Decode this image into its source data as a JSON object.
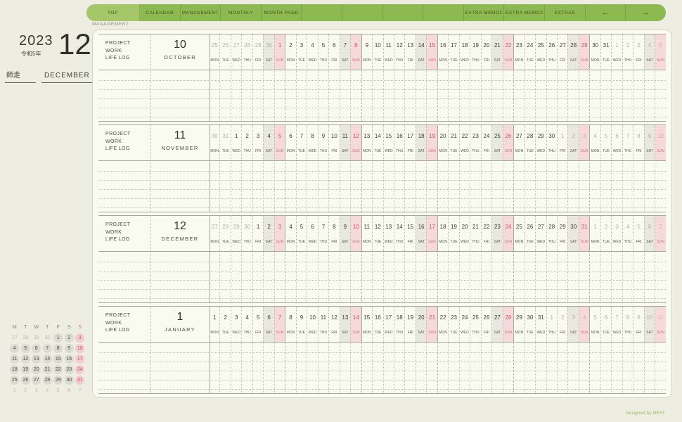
{
  "tab_bar": {
    "left_tabs": [
      "TOP",
      "CALENDAR",
      "MANAGEMENT",
      "MONTHLY",
      "MONTH PAGE"
    ],
    "right_tabs": [
      "EXTRA MEMO1",
      "EXTRA MEMO2",
      "EXTRAS"
    ],
    "nav_arrows": [
      "←",
      "→"
    ],
    "active_tab": "TOP"
  },
  "page_label": "MANAGEMENT",
  "title_block": {
    "year": "2023",
    "era": "令和5年",
    "month_number": "12",
    "month_jp": "師走",
    "month_en": "DECEMBER"
  },
  "row_labels": [
    "PROJECT",
    "WORK",
    "LIFE LOG"
  ],
  "weekday_labels": [
    "MON",
    "TUE",
    "WED",
    "THU",
    "FRI",
    "SAT",
    "SUN"
  ],
  "months": [
    {
      "number": "10",
      "name": "OCTOBER",
      "out_before": 6,
      "out_after": 5,
      "dates": [
        25,
        26,
        27,
        28,
        29,
        30,
        1,
        2,
        3,
        4,
        5,
        6,
        7,
        8,
        9,
        10,
        11,
        12,
        13,
        14,
        15,
        16,
        17,
        18,
        19,
        20,
        21,
        22,
        23,
        24,
        25,
        26,
        27,
        28,
        29,
        30,
        31,
        1,
        2,
        3,
        4,
        5
      ]
    },
    {
      "number": "11",
      "name": "NOVEMBER",
      "out_before": 2,
      "out_after": 10,
      "dates": [
        30,
        31,
        1,
        2,
        3,
        4,
        5,
        6,
        7,
        8,
        9,
        10,
        11,
        12,
        13,
        14,
        15,
        16,
        17,
        18,
        19,
        20,
        21,
        22,
        23,
        24,
        25,
        26,
        27,
        28,
        29,
        30,
        1,
        2,
        3,
        4,
        5,
        6,
        7,
        8,
        9,
        10
      ]
    },
    {
      "number": "12",
      "name": "DECEMBER",
      "out_before": 4,
      "out_after": 7,
      "dates": [
        27,
        28,
        29,
        30,
        1,
        2,
        3,
        4,
        5,
        6,
        7,
        8,
        9,
        10,
        11,
        12,
        13,
        14,
        15,
        16,
        17,
        18,
        19,
        20,
        21,
        22,
        23,
        24,
        25,
        26,
        27,
        28,
        29,
        30,
        31,
        1,
        2,
        3,
        4,
        5,
        6,
        7
      ]
    },
    {
      "number": "1",
      "name": "JANUARY",
      "out_before": 0,
      "out_after": 11,
      "dates": [
        1,
        2,
        3,
        4,
        5,
        6,
        7,
        8,
        9,
        10,
        11,
        12,
        13,
        14,
        15,
        16,
        17,
        18,
        19,
        20,
        21,
        22,
        23,
        24,
        25,
        26,
        27,
        28,
        29,
        30,
        31,
        1,
        2,
        3,
        4,
        5,
        6,
        7,
        8,
        9,
        10,
        11
      ]
    }
  ],
  "mini_calendar": {
    "headers": [
      "M",
      "T",
      "W",
      "T",
      "F",
      "S",
      "S"
    ],
    "weeks": [
      {
        "days": [
          27,
          28,
          29,
          30,
          1,
          2,
          3
        ],
        "out_before": 4,
        "out_after": 0
      },
      {
        "days": [
          4,
          5,
          6,
          7,
          8,
          9,
          10
        ],
        "out_before": 0,
        "out_after": 0
      },
      {
        "days": [
          11,
          12,
          13,
          14,
          15,
          16,
          17
        ],
        "out_before": 0,
        "out_after": 0
      },
      {
        "days": [
          18,
          19,
          20,
          21,
          22,
          23,
          24
        ],
        "out_before": 0,
        "out_after": 0
      },
      {
        "days": [
          25,
          26,
          27,
          28,
          29,
          30,
          31
        ],
        "out_before": 0,
        "out_after": 0
      },
      {
        "days": [
          1,
          2,
          3,
          4,
          5,
          6,
          7
        ],
        "out_before": 7,
        "out_after": 0
      }
    ]
  },
  "footer": "Designed by NEST",
  "colors": {
    "accent_green": "#8cb950",
    "active_tab_green": "#a5c76a",
    "sunday_red": "#c85a64",
    "sunday_bg": "#f6dadb",
    "saturday_bg": "#e8e8e1",
    "panel_bg": "#fafbf0"
  }
}
